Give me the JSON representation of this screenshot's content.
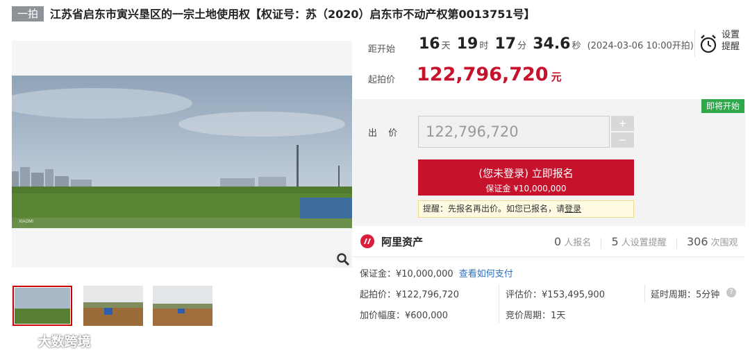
{
  "header": {
    "badge": "一拍",
    "title": "江苏省启东市寅兴垦区的一宗土地使用权【权证号：苏（2020）启东市不动产权第0013751号】"
  },
  "countdown": {
    "label": "距开始",
    "days": "16",
    "days_unit": "天",
    "hours": "19",
    "hours_unit": "时",
    "minutes": "17",
    "minutes_unit": "分",
    "seconds": "34.6",
    "seconds_unit": "秒",
    "start_time": "(2024-03-06 10:00开拍)"
  },
  "alarm": {
    "label": "设置提醒",
    "icon": "alarm-clock-icon"
  },
  "start_price": {
    "label": "起拍价",
    "value": "122,796,720",
    "unit": "元"
  },
  "bid": {
    "status_badge": "即将开始",
    "label": "出 价",
    "input_value": "122,796,720",
    "plus": "+",
    "minus": "−",
    "register_main": "(您未登录) 立即报名",
    "register_sub": "保证金 ¥10,000,000",
    "notice_prefix": "提醒：先报名再出价。如您已报名，请",
    "notice_link": "登录"
  },
  "brand": {
    "name": "阿里资产"
  },
  "stats": {
    "registered": "0",
    "registered_label": "人报名",
    "reminders": "5",
    "reminders_label": "人设置提醒",
    "views": "306",
    "views_label": "次围观"
  },
  "details": {
    "deposit": "保证金：¥10,000,000",
    "deposit_link": "查看如何支付",
    "start_price": "起拍价：¥122,796,720",
    "appraisal": "评估价：¥153,495,900",
    "delay": "延时周期：5分钟",
    "increment": "加价幅度：¥600,000",
    "cycle": "竞价周期：1天",
    "help": "?"
  },
  "watermark": {
    "text": "大数跨境"
  },
  "photo": {
    "caption": "XIAOMI"
  }
}
